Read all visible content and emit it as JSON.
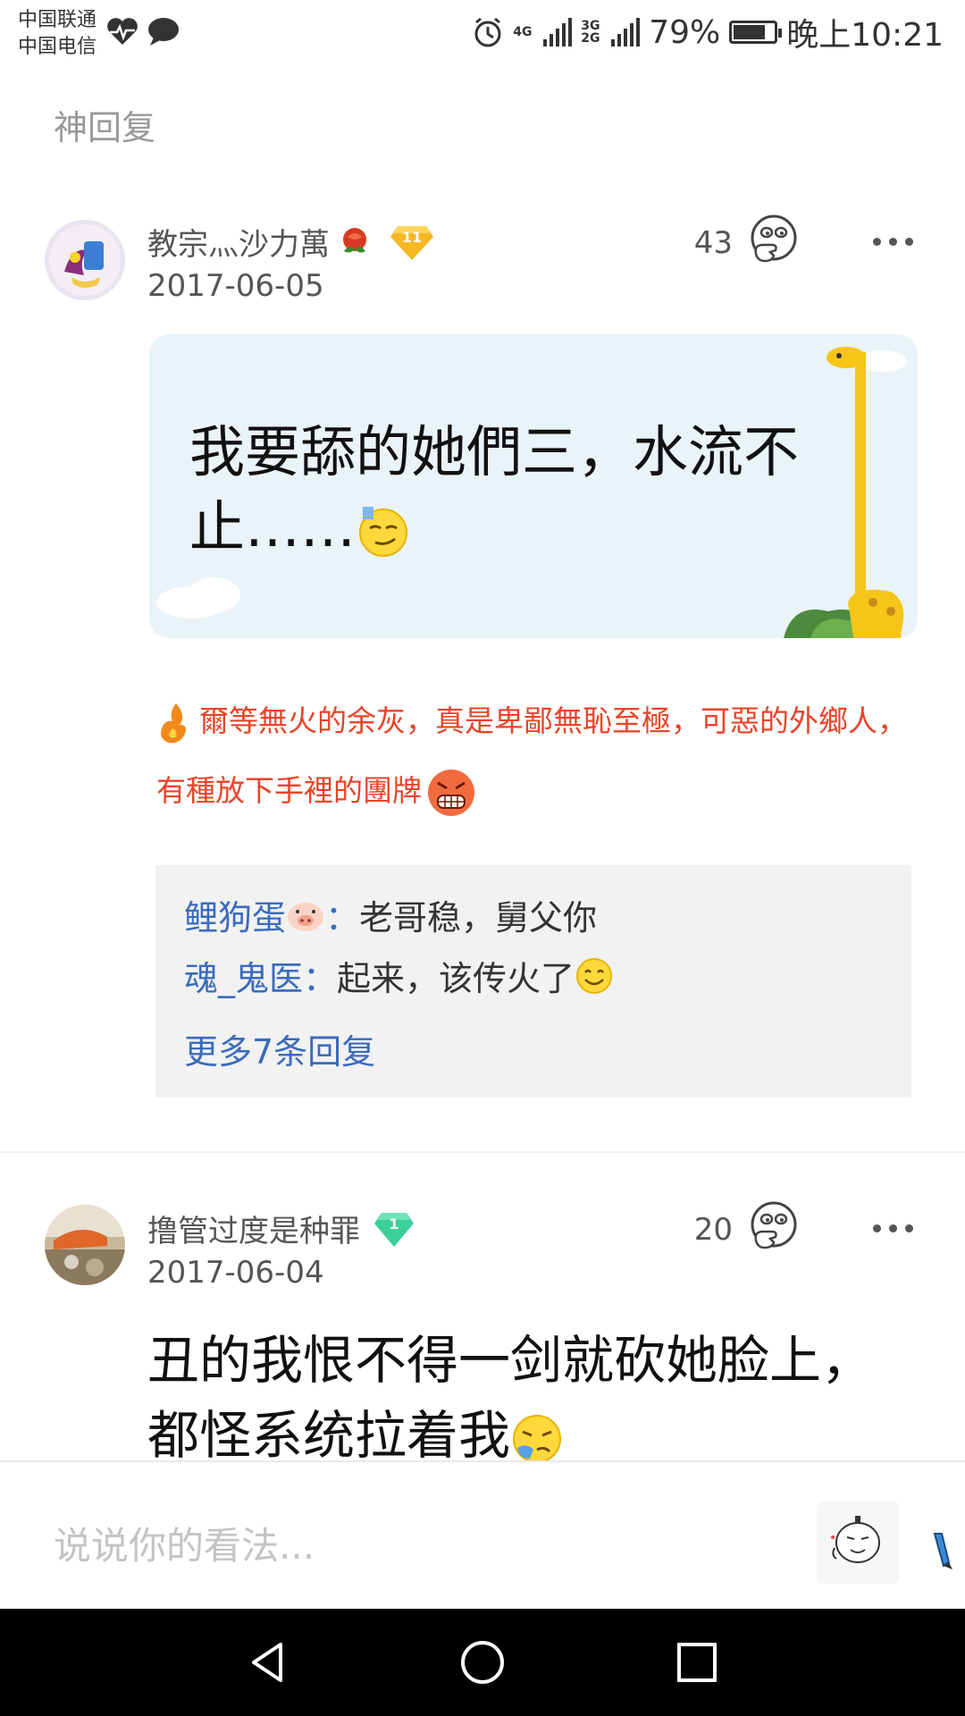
{
  "status_bar": {
    "carrier1": "中国联通",
    "carrier2": "中国电信",
    "net1": "4G",
    "net2": "3G 2G",
    "battery": "79%",
    "battery_level": 0.79,
    "time": "晚上10:21"
  },
  "section": {
    "title": "神回复"
  },
  "comments": [
    {
      "username": "教宗灬沙力萬",
      "level": "11",
      "date": "2017-06-05",
      "likes": "43",
      "content": "我要舔的她們三，水流不止……",
      "signature": "爾等無火的余灰，真是卑鄙無恥至極，可惡的外鄉人，有種放下手裡的團牌",
      "replies": [
        {
          "name": "鲤狗蛋",
          "sep": "：",
          "text": "老哥稳，舅父你"
        },
        {
          "name": "魂_鬼医",
          "sep": "：",
          "text": "起来，该传火了"
        }
      ],
      "more_replies": "更多7条回复"
    },
    {
      "username": "撸管过度是种罪",
      "level": "1",
      "date": "2017-06-04",
      "likes": "20",
      "content": "丑的我恨不得一剑就砍她脸上，都怪系统拉着我"
    }
  ],
  "input": {
    "placeholder": "说说你的看法..."
  },
  "colors": {
    "link": "#3a6cbc",
    "signature": "#e8442a",
    "level_gold": "#f6b824",
    "level_green": "#3ccf9a"
  }
}
